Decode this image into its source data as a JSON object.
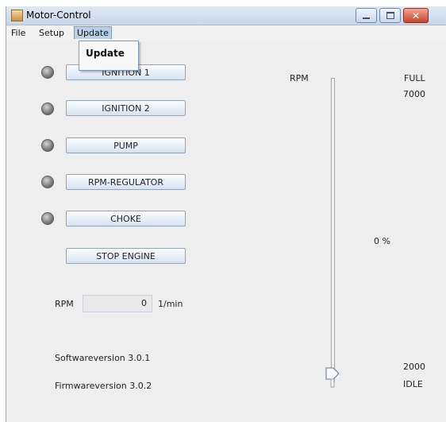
{
  "window": {
    "title": "Motor-Control"
  },
  "menubar": {
    "file": "File",
    "setup": "Setup",
    "update": "Update"
  },
  "dropdown": {
    "update_item": "Update"
  },
  "buttons": {
    "ignition1": "IGNITION 1",
    "ignition2": "IGNITION 2",
    "pump": "PUMP",
    "rpm_regulator": "RPM-REGULATOR",
    "choke": "CHOKE",
    "stop_engine": "STOP ENGINE"
  },
  "rpm": {
    "label": "RPM",
    "value": "0",
    "unit": "1/min"
  },
  "versions": {
    "software": "Softwareversion 3.0.1",
    "firmware": "Firmwareversion 3.0.2"
  },
  "slider": {
    "label": "RPM",
    "top_label": "FULL",
    "top_value": "7000",
    "percent": "0 %",
    "bottom_value": "2000",
    "bottom_label": "IDLE",
    "level": 0
  },
  "colors": {
    "titlebar": "#c7d7ea",
    "close_button": "#c9462c",
    "menu_highlight": "#b8cfe5"
  }
}
